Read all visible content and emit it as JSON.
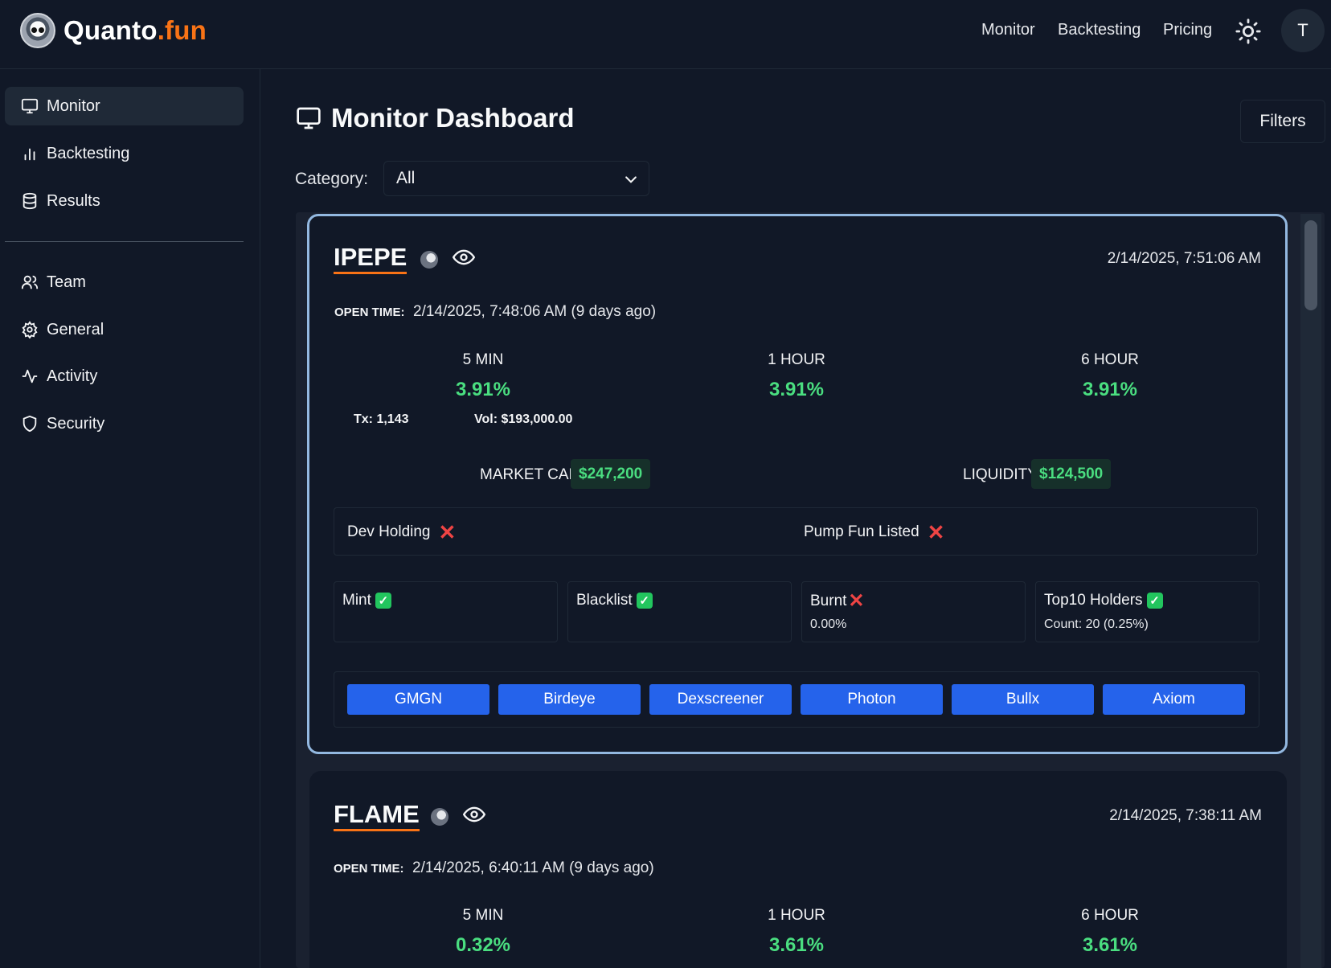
{
  "brand": {
    "name": "Quanto",
    "suffix": ".fun",
    "accent_color": "#f97316"
  },
  "topnav": {
    "links": [
      "Monitor",
      "Backtesting",
      "Pricing"
    ],
    "theme_icon": "sun-icon",
    "avatar_initial": "T"
  },
  "sidebar": {
    "primary": [
      {
        "label": "Monitor",
        "icon": "monitor-icon",
        "active": true
      },
      {
        "label": "Backtesting",
        "icon": "bar-chart-icon",
        "active": false
      },
      {
        "label": "Results",
        "icon": "database-icon",
        "active": false
      }
    ],
    "secondary": [
      {
        "label": "Team",
        "icon": "users-icon"
      },
      {
        "label": "General",
        "icon": "gear-icon"
      },
      {
        "label": "Activity",
        "icon": "activity-icon"
      },
      {
        "label": "Security",
        "icon": "shield-icon"
      }
    ]
  },
  "main": {
    "title": "Monitor Dashboard",
    "filters_label": "Filters",
    "category_label": "Category:",
    "category_value": "All"
  },
  "cards": [
    {
      "name": "IPEPE",
      "date": "2/14/2025, 7:51:06 AM",
      "open_time_label": "OPEN TIME:",
      "open_time": "2/14/2025, 7:48:06 AM (9 days ago)",
      "timeframes": [
        {
          "label": "5 MIN",
          "value": "3.91%"
        },
        {
          "label": "1 HOUR",
          "value": "3.91%"
        },
        {
          "label": "6 HOUR",
          "value": "3.91%"
        }
      ],
      "tx": "Tx: 1,143",
      "vol": "Vol: $193,000.00",
      "market_cap_label": "MARKET CAP",
      "market_cap": "$247,200",
      "liquidity_label": "LIQUIDITY",
      "liquidity": "$124,500",
      "flags": [
        {
          "label": "Dev Holding",
          "status": "✕"
        },
        {
          "label": "Pump Fun Listed",
          "status": "✕"
        }
      ],
      "security": [
        {
          "label": "Mint",
          "status": "✓",
          "sub": ""
        },
        {
          "label": "Blacklist",
          "status": "✓",
          "sub": ""
        },
        {
          "label": "Burnt",
          "status": "✕",
          "sub": "0.00%"
        },
        {
          "label": "Top10 Holders",
          "status": "✓",
          "sub": "Count: 20 (0.25%)"
        }
      ],
      "links": [
        "GMGN",
        "Birdeye",
        "Dexscreener",
        "Photon",
        "Bullx",
        "Axiom"
      ]
    },
    {
      "name": "FLAME",
      "date": "2/14/2025, 7:38:11 AM",
      "open_time_label": "OPEN TIME:",
      "open_time": "2/14/2025, 6:40:11 AM (9 days ago)",
      "timeframes": [
        {
          "label": "5 MIN",
          "value": "0.32%"
        },
        {
          "label": "1 HOUR",
          "value": "3.61%"
        },
        {
          "label": "6 HOUR",
          "value": "3.61%"
        }
      ]
    }
  ],
  "colors": {
    "positive": "#4ade80",
    "negative": "#ef4444",
    "button": "#2563eb",
    "selected_border": "#93b8e0"
  }
}
